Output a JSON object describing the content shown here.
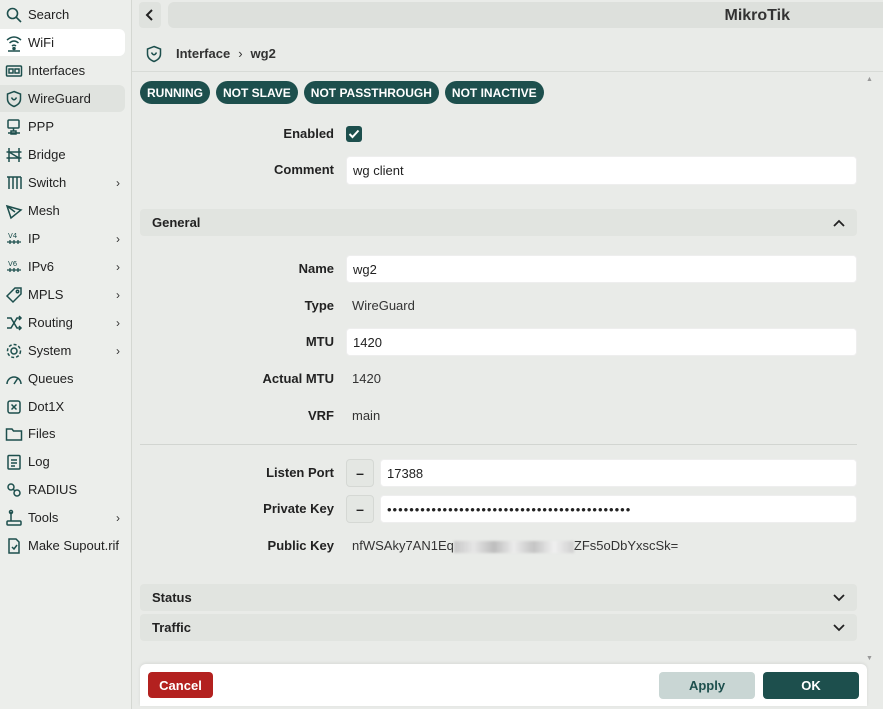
{
  "app": {
    "title": "MikroTik"
  },
  "sidebar": {
    "items": [
      {
        "label": "Search",
        "icon": "search-icon",
        "chevron": false
      },
      {
        "label": "WiFi",
        "icon": "wifi-icon",
        "chevron": false
      },
      {
        "label": "Interfaces",
        "icon": "interfaces-icon",
        "chevron": false
      },
      {
        "label": "WireGuard",
        "icon": "wireguard-icon",
        "chevron": false
      },
      {
        "label": "PPP",
        "icon": "ppp-icon",
        "chevron": false
      },
      {
        "label": "Bridge",
        "icon": "bridge-icon",
        "chevron": false
      },
      {
        "label": "Switch",
        "icon": "switch-icon",
        "chevron": true
      },
      {
        "label": "Mesh",
        "icon": "mesh-icon",
        "chevron": false
      },
      {
        "label": "IP",
        "icon": "ipv4-icon",
        "chevron": true
      },
      {
        "label": "IPv6",
        "icon": "ipv6-icon",
        "chevron": true
      },
      {
        "label": "MPLS",
        "icon": "mpls-icon",
        "chevron": true
      },
      {
        "label": "Routing",
        "icon": "routing-icon",
        "chevron": true
      },
      {
        "label": "System",
        "icon": "gear-icon",
        "chevron": true
      },
      {
        "label": "Queues",
        "icon": "queues-icon",
        "chevron": false
      },
      {
        "label": "Dot1X",
        "icon": "dot1x-icon",
        "chevron": false
      },
      {
        "label": "Files",
        "icon": "folder-icon",
        "chevron": false
      },
      {
        "label": "Log",
        "icon": "log-icon",
        "chevron": false
      },
      {
        "label": "RADIUS",
        "icon": "radius-icon",
        "chevron": false
      },
      {
        "label": "Tools",
        "icon": "tools-icon",
        "chevron": true
      },
      {
        "label": "Make Supout.rif",
        "icon": "supout-icon",
        "chevron": false
      }
    ]
  },
  "breadcrumb": {
    "parent": "Interface",
    "current": "wg2"
  },
  "badges": [
    "RUNNING",
    "NOT SLAVE",
    "NOT PASSTHROUGH",
    "NOT INACTIVE"
  ],
  "form": {
    "enabled_label": "Enabled",
    "comment_label": "Comment",
    "comment_value": "wg client",
    "general_section": "General",
    "name_label": "Name",
    "name_value": "wg2",
    "type_label": "Type",
    "type_value": "WireGuard",
    "mtu_label": "MTU",
    "mtu_value": "1420",
    "actual_mtu_label": "Actual MTU",
    "actual_mtu_value": "1420",
    "vrf_label": "VRF",
    "vrf_value": "main",
    "listen_port_label": "Listen Port",
    "listen_port_value": "17388",
    "private_key_label": "Private Key",
    "private_key_value": "••••••••••••••••••••••••••••••••••••••••••••",
    "public_key_label": "Public Key",
    "public_key_prefix": "nfWSAky7AN1Eq",
    "public_key_suffix": "ZFs5oDbYxscSk=",
    "status_section": "Status",
    "traffic_section": "Traffic",
    "minus": "–"
  },
  "footer": {
    "cancel": "Cancel",
    "apply": "Apply",
    "ok": "OK"
  },
  "colors": {
    "accent": "#1d4f4d",
    "danger": "#b3211f",
    "apply_bg": "#c9d6d4"
  }
}
